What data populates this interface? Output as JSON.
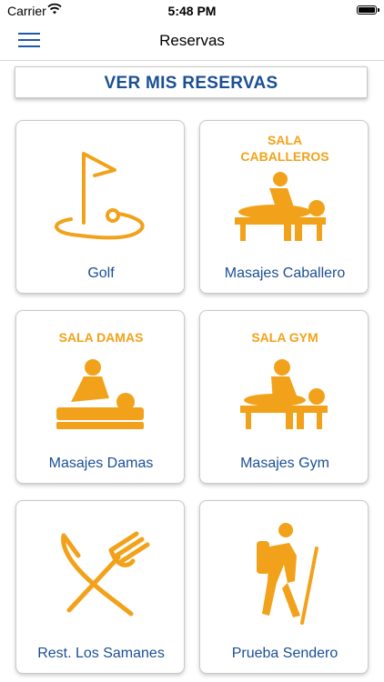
{
  "status": {
    "carrier": "Carrier",
    "time": "5:48 PM"
  },
  "nav": {
    "title": "Reservas"
  },
  "view_button": {
    "label": "VER MIS RESERVAS"
  },
  "colors": {
    "accent": "#f2a21a",
    "text_blue": "#1b4f94"
  },
  "cards": [
    {
      "label": "Golf",
      "icon": "golf-flag-icon",
      "caption": ""
    },
    {
      "label": "Masajes Caballero",
      "icon": "massage-icon",
      "caption_line1": "SALA",
      "caption_line2": "CABALLEROS"
    },
    {
      "label": "Masajes Damas",
      "icon": "massage-icon",
      "caption_line1": "SALA DAMAS"
    },
    {
      "label": "Masajes Gym",
      "icon": "massage-icon",
      "caption_line1": "SALA GYM"
    },
    {
      "label": "Rest. Los Samanes",
      "icon": "knife-fork-icon"
    },
    {
      "label": "Prueba Sendero",
      "icon": "hiker-icon"
    }
  ]
}
